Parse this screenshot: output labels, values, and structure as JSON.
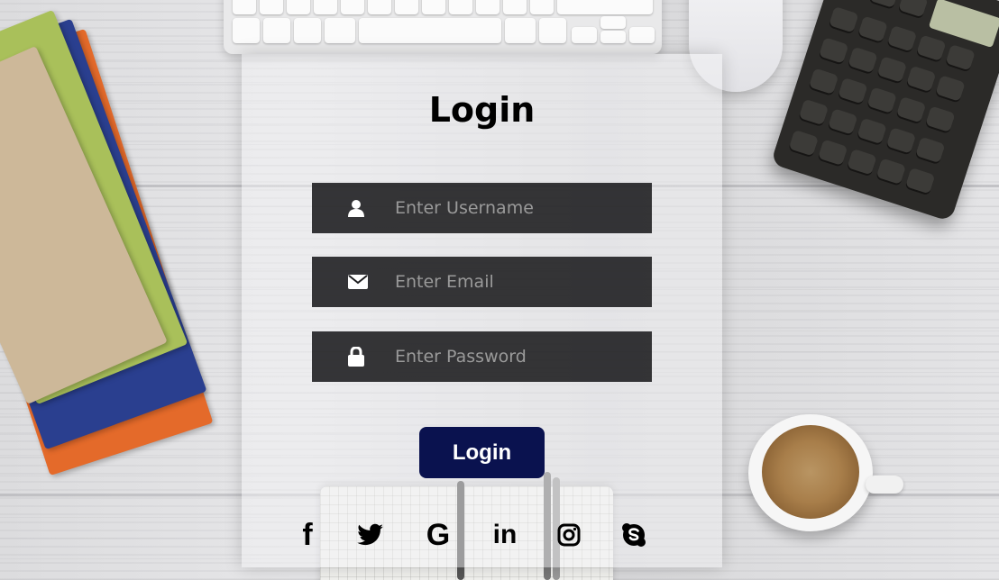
{
  "login_form": {
    "title": "Login",
    "username": {
      "placeholder": "Enter Username",
      "icon": "user-icon"
    },
    "email": {
      "placeholder": "Enter Email",
      "icon": "envelope-icon"
    },
    "password": {
      "placeholder": "Enter Password",
      "icon": "lock-icon"
    },
    "submit_label": "Login",
    "submit_color": "#0a124f"
  },
  "social_links": [
    {
      "name": "facebook",
      "icon": "facebook-icon",
      "glyph": "f"
    },
    {
      "name": "twitter",
      "icon": "twitter-icon"
    },
    {
      "name": "google",
      "icon": "google-icon",
      "glyph": "G"
    },
    {
      "name": "linkedin",
      "icon": "linkedin-icon",
      "glyph": "in"
    },
    {
      "name": "instagram",
      "icon": "instagram-icon"
    },
    {
      "name": "skype",
      "icon": "skype-icon"
    }
  ]
}
